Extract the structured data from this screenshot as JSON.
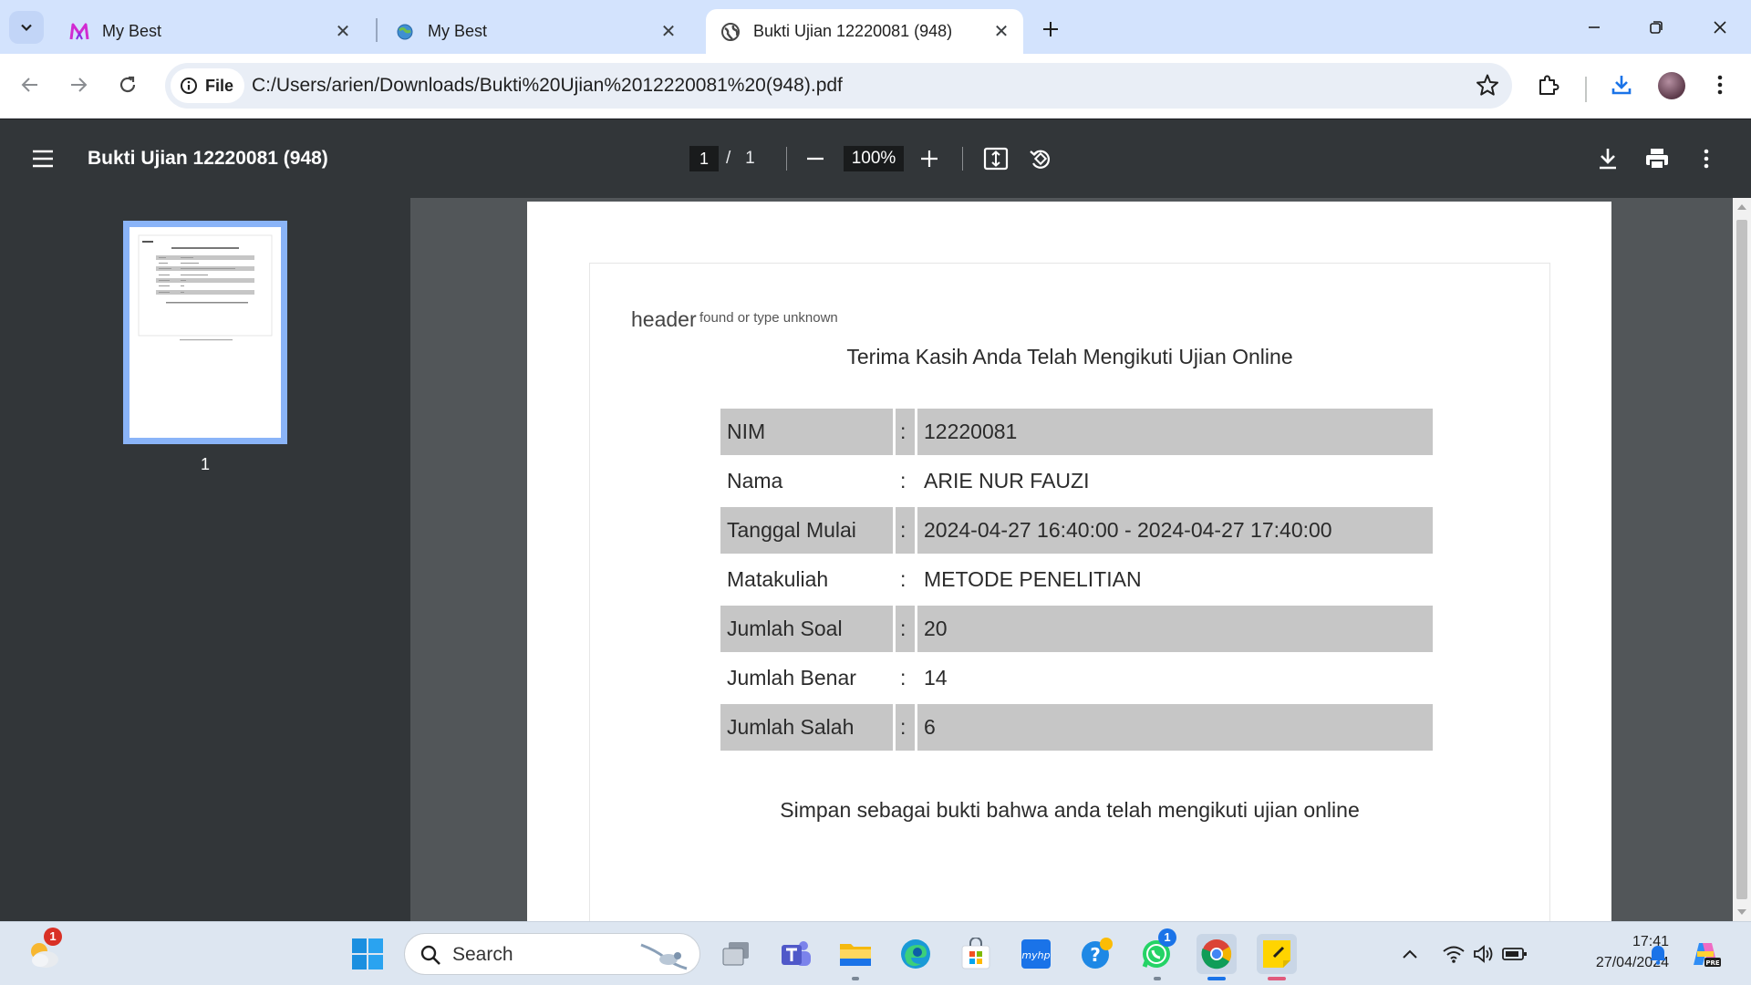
{
  "browser": {
    "tabs": [
      {
        "title": "My Best",
        "favicon": "mybest-m-icon"
      },
      {
        "title": "My Best",
        "favicon": "globe-icon"
      },
      {
        "title": "Bukti Ujian 12220081 (948)",
        "favicon": "globe-icon",
        "active": true
      }
    ],
    "address": {
      "scheme_label": "File",
      "url": "C:/Users/arien/Downloads/Bukti%20Ujian%2012220081%20(948).pdf"
    }
  },
  "pdf_viewer": {
    "title": "Bukti Ujian 12220081 (948)",
    "current_page": "1",
    "page_separator": "/",
    "total_pages": "1",
    "zoom": "100%",
    "thumbnail_label": "1"
  },
  "document": {
    "broken_image_alt": "header",
    "broken_image_note": "found or type unknown",
    "title": "Terima Kasih Anda Telah Mengikuti Ujian Online",
    "rows": [
      {
        "label": "NIM",
        "sep": ":",
        "value": "12220081"
      },
      {
        "label": "Nama",
        "sep": ":",
        "value": "ARIE NUR FAUZI"
      },
      {
        "label": "Tanggal Mulai",
        "sep": ":",
        "value": "2024-04-27 16:40:00 - 2024-04-27 17:40:00"
      },
      {
        "label": "Matakuliah",
        "sep": ":",
        "value": "METODE PENELITIAN"
      },
      {
        "label": "Jumlah Soal",
        "sep": ":",
        "value": "20"
      },
      {
        "label": "Jumlah Benar",
        "sep": ":",
        "value": "14"
      },
      {
        "label": "Jumlah Salah",
        "sep": ":",
        "value": "6"
      }
    ],
    "footer_note": "Simpan sebagai bukti bahwa anda telah mengikuti ujian online",
    "row_shade_color": "#c6c6c6"
  },
  "taskbar": {
    "search_placeholder": "Search",
    "weather_badge": "1",
    "whatsapp_badge": "1",
    "time": "17:41",
    "date": "27/04/2024"
  },
  "colors": {
    "tabstrip_bg": "#d3e3fd",
    "pdf_toolbar_bg": "#323639",
    "pdf_viewport_bg": "#525659",
    "thumbnail_highlight": "#8ab4f8",
    "download_icon": "#1a73e8"
  }
}
